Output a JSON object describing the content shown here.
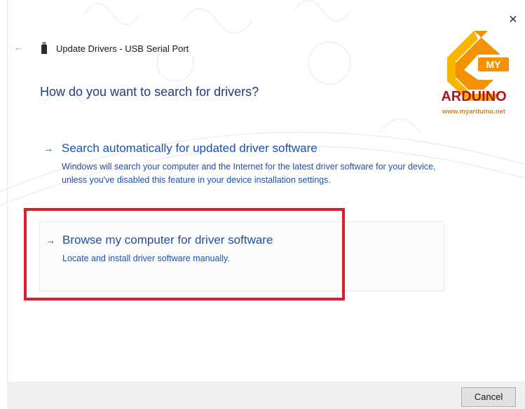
{
  "window": {
    "title": "Update Drivers - USB Serial Port",
    "close_glyph": "✕",
    "back_glyph": "←"
  },
  "page": {
    "title": "How do you want to search for drivers?"
  },
  "options": [
    {
      "arrow": "→",
      "title": "Search automatically for updated driver software",
      "description": "Windows will search your computer and the Internet for the latest driver software for your device, unless you've disabled this feature in your device installation settings."
    },
    {
      "arrow": "→",
      "title": "Browse my computer for driver software",
      "description": "Locate and install driver software manually."
    }
  ],
  "logo": {
    "badge": "MY",
    "name": "ARDUINO",
    "url": "www.myarduino.net"
  },
  "footer": {
    "cancel_label": "Cancel"
  },
  "colors": {
    "link_blue": "#1f4fa8",
    "title_blue": "#1f3d7a",
    "highlight_red": "#d8202c",
    "logo_orange": "#f39200",
    "logo_red": "#b3131b"
  },
  "icons": {
    "back": "arrow-left-icon",
    "device": "usb-device-icon",
    "close": "close-icon",
    "option_arrow": "arrow-right-icon"
  }
}
